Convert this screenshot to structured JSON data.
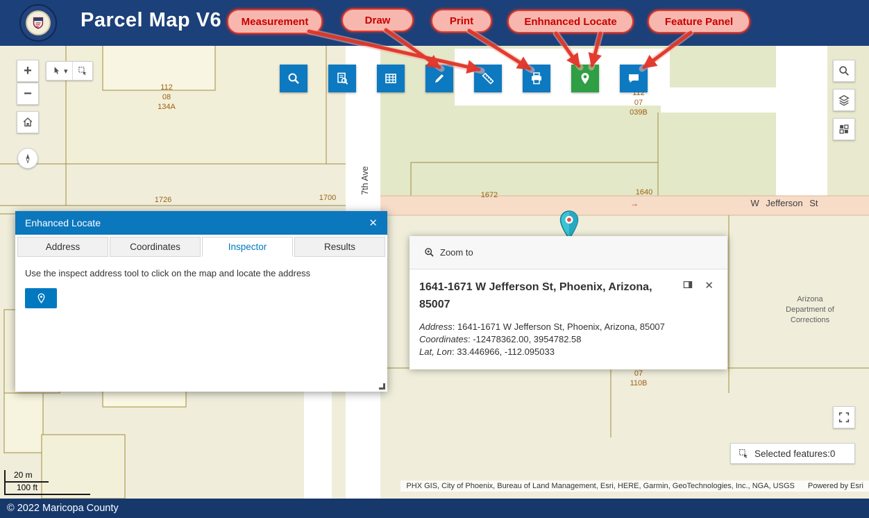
{
  "colors": {
    "header_navy": "#1c4079",
    "footer_navy": "#16386b",
    "toolbar_blue": "#0d79c0",
    "locate_green": "#2f9e44",
    "annotation_red": "#c80000",
    "panel_header_blue": "#0b77bd",
    "map_base": "#f0eedb",
    "map_green_parcel": "#e3e8c9",
    "road_pink": "#f7dcc8"
  },
  "header": {
    "title": "Parcel Map V6"
  },
  "annotations": {
    "labels": [
      {
        "text": "Measurement"
      },
      {
        "text": "Draw"
      },
      {
        "text": "Print"
      },
      {
        "text": "Enhnanced Locate"
      },
      {
        "text": "Feature Panel"
      }
    ]
  },
  "toolbar_icons": [
    "magnifier",
    "document-search",
    "table-grid",
    "pencil",
    "measure-ruler",
    "printer",
    "locate-pin",
    "speech-bubble"
  ],
  "icons": {
    "zoom_in": "+",
    "zoom_out": "−",
    "close": "✕",
    "caret_down": "▾",
    "one_way_arrow": "→"
  },
  "enhanced_locate_panel": {
    "title": "Enhanced Locate",
    "tabs": [
      {
        "label": "Address"
      },
      {
        "label": "Coordinates"
      },
      {
        "label": "Inspector",
        "active": true
      },
      {
        "label": "Results"
      }
    ],
    "instruction": "Use the inspect address tool to click on the map and locate the address"
  },
  "popup": {
    "zoom_to_label": "Zoom to",
    "title": "1641-1671 W Jefferson St, Phoenix, Arizona, 85007",
    "fields": [
      {
        "label": "Address",
        "value": "1641-1671 W Jefferson St, Phoenix, Arizona, 85007"
      },
      {
        "label": "Coordinates",
        "value": "-12478362.00, 3954782.58"
      },
      {
        "label": "Lat, Lon",
        "value": "33.446966, -112.095033"
      }
    ]
  },
  "map": {
    "parcel_labels": [
      {
        "text": "112\n08\n134A"
      },
      {
        "text": "112\n07\n039B"
      },
      {
        "text": "07\n110B"
      },
      {
        "text": "1726"
      },
      {
        "text": "1700"
      },
      {
        "text": "1672"
      },
      {
        "text": "1640"
      }
    ],
    "street_labels": [
      {
        "text": "W Jefferson St"
      },
      {
        "text": "7th Ave"
      }
    ],
    "area_labels": [
      {
        "text": "Arizona\nDepartment of\nCorrections"
      }
    ],
    "selected_features_label": "Selected features:0",
    "scalebar": {
      "metric": "20 m",
      "imperial": "100 ft"
    },
    "attribution": "PHX GIS, City of Phoenix, Bureau of Land Management, Esri, HERE, Garmin, GeoTechnologies, Inc., NGA, USGS",
    "powered_by": "Powered by Esri"
  },
  "footer": {
    "copyright": "© 2022 Maricopa County"
  }
}
